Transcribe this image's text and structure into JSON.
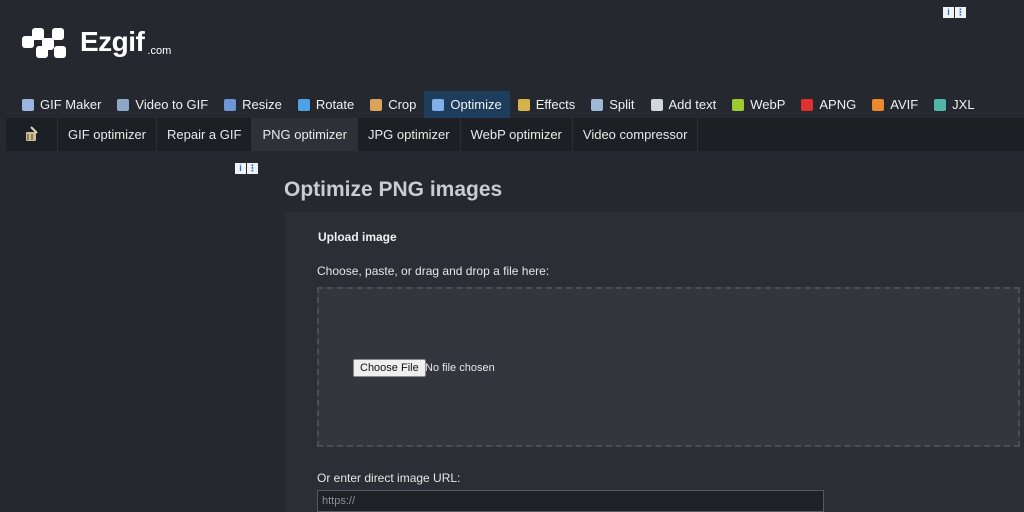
{
  "logo": {
    "name": "Ezgif",
    "suffix": ".com"
  },
  "main_nav": [
    {
      "label": "GIF Maker",
      "icon": "gif-maker-icon",
      "color": "#9bb7e0"
    },
    {
      "label": "Video to GIF",
      "icon": "video-icon",
      "color": "#8fa6c9"
    },
    {
      "label": "Resize",
      "icon": "resize-icon",
      "color": "#6f95d8"
    },
    {
      "label": "Rotate",
      "icon": "rotate-icon",
      "color": "#4da3e6"
    },
    {
      "label": "Crop",
      "icon": "crop-icon",
      "color": "#d9a35b"
    },
    {
      "label": "Optimize",
      "icon": "optimize-icon",
      "color": "#7fb0e8"
    },
    {
      "label": "Effects",
      "icon": "effects-icon",
      "color": "#d6b24a"
    },
    {
      "label": "Split",
      "icon": "split-icon",
      "color": "#9db8d8"
    },
    {
      "label": "Add text",
      "icon": "add-text-icon",
      "color": "#cfd7e0"
    },
    {
      "label": "WebP",
      "icon": "webp-icon",
      "color": "#9ccc2e"
    },
    {
      "label": "APNG",
      "icon": "apng-icon",
      "color": "#e03030"
    },
    {
      "label": "AVIF",
      "icon": "avif-icon",
      "color": "#e98a2e"
    },
    {
      "label": "JXL",
      "icon": "jxl-icon",
      "color": "#4fb6a8"
    }
  ],
  "active_main": "Optimize",
  "sub_nav": [
    {
      "label": "GIF optimizer"
    },
    {
      "label": "Repair a GIF"
    },
    {
      "label": "PNG optimizer"
    },
    {
      "label": "JPG optimizer"
    },
    {
      "label": "WebP optimizer"
    },
    {
      "label": "Video compressor"
    }
  ],
  "active_sub": "PNG optimizer",
  "page": {
    "title": "Optimize PNG images"
  },
  "upload": {
    "legend": "Upload image",
    "instruction": "Choose, paste, or drag and drop a file here:",
    "choose_button": "Choose File",
    "file_status": "No file chosen",
    "url_label": "Or enter direct image URL:",
    "url_placeholder": "https://"
  }
}
